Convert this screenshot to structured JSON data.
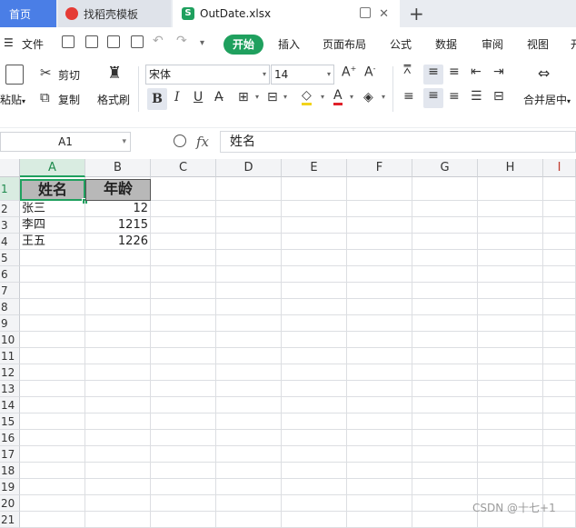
{
  "tabs": {
    "home": "首页",
    "daoke": "找稻壳模板",
    "file": "OutDate.xlsx"
  },
  "menu": {
    "file": "文件",
    "start": "开始",
    "insert": "插入",
    "page_layout": "页面布局",
    "formulas": "公式",
    "data": "数据",
    "review": "审阅",
    "view": "视图",
    "more": "开"
  },
  "ribbon": {
    "paste": "粘贴",
    "cut": "剪切",
    "copy": "复制",
    "format_painter": "格式刷",
    "font_name": "宋体",
    "font_size": "14",
    "merge_center": "合并居中"
  },
  "formula_bar": {
    "cell_ref": "A1",
    "fx": "fx",
    "content": "姓名"
  },
  "sheet": {
    "columns": [
      "A",
      "B",
      "C",
      "D",
      "E",
      "F",
      "G",
      "H",
      "I"
    ],
    "rows": [
      "1",
      "2",
      "3",
      "4",
      "5",
      "6",
      "7",
      "8",
      "9",
      "10",
      "11",
      "12",
      "13",
      "14",
      "15",
      "16",
      "17",
      "18",
      "19",
      "20",
      "21"
    ],
    "header": {
      "a1": "姓名",
      "b1": "年龄"
    },
    "data": [
      {
        "name": "张三",
        "age": "12"
      },
      {
        "name": "李四",
        "age": "1215"
      },
      {
        "name": "王五",
        "age": "1226"
      }
    ]
  },
  "watermark": "CSDN @十七+1"
}
